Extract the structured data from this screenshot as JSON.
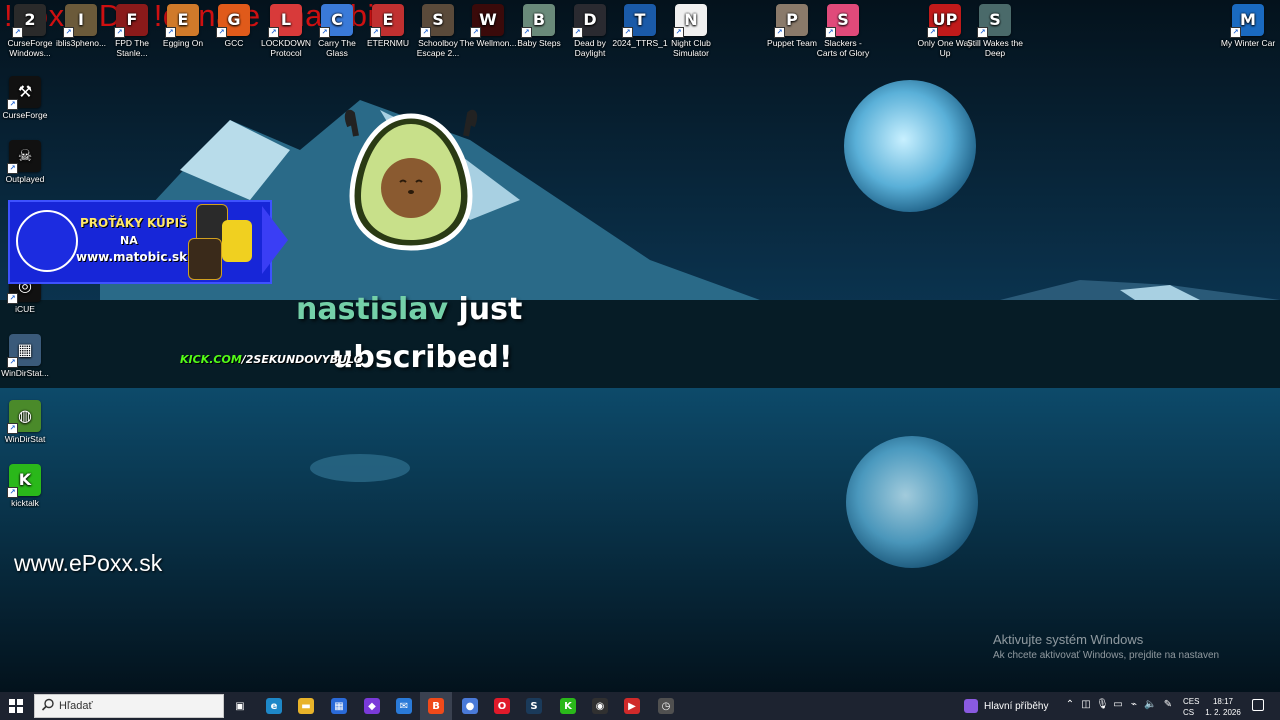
{
  "overlay": {
    "commands_text": "!doxx !DC !donate !matobic",
    "alert_user": "nastislav",
    "alert_just": "just",
    "alert_line2": "ubscribed!",
    "kick_prefix": "KICK.COM",
    "kick_suffix": "/2SEKUNDOVYBULO",
    "site_url": "www.ePoxx.sk",
    "promo": {
      "line1": "PROŤÁKY KÚPIŠ",
      "line2": "NA",
      "line3": "www.matobic.sk"
    }
  },
  "desktop": {
    "icons_top": [
      {
        "label": "CurseForge Windows...",
        "icon": "curseforge-icon",
        "color": "#2a2a2a",
        "glyph": "2"
      },
      {
        "label": "iblis3pheno...",
        "icon": "game-icon",
        "color": "#6b5a3a",
        "glyph": "I"
      },
      {
        "label": "FPD The Stanle...",
        "icon": "game-icon",
        "color": "#8a1a1a",
        "glyph": "F"
      },
      {
        "label": "Egging On",
        "icon": "egg-icon",
        "color": "#d07a2a",
        "glyph": "E"
      },
      {
        "label": "GCC",
        "icon": "gcc-icon",
        "color": "#e05a1a",
        "glyph": "G"
      },
      {
        "label": "LOCKDOWN Protocol",
        "icon": "game-icon",
        "color": "#d83a3a",
        "glyph": "L"
      },
      {
        "label": "Carry The Glass",
        "icon": "game-icon",
        "color": "#3a7ad8",
        "glyph": "C"
      },
      {
        "label": "ETERNMU",
        "icon": "game-icon",
        "color": "#c03030",
        "glyph": "E"
      },
      {
        "label": "Schoolboy Escape 2...",
        "icon": "game-icon",
        "color": "#5a4a3a",
        "glyph": "S"
      },
      {
        "label": "The Wellmon...",
        "icon": "game-icon",
        "color": "#3a0a0a",
        "glyph": "W"
      },
      {
        "label": "Baby Steps",
        "icon": "game-icon",
        "color": "#6a8a7a",
        "glyph": "B"
      },
      {
        "label": "Dead by Daylight",
        "icon": "game-icon",
        "color": "#2a2a30",
        "glyph": "D"
      },
      {
        "label": "2024_TTRS_1",
        "icon": "game-icon",
        "color": "#1a5aa8",
        "glyph": "T"
      },
      {
        "label": "Night Club Simulator",
        "icon": "game-icon",
        "color": "#f0f0f0",
        "glyph": "N"
      },
      {
        "label": "Puppet Team",
        "icon": "game-icon",
        "color": "#8a7a6a",
        "glyph": "P"
      },
      {
        "label": "Slackers - Carts of Glory",
        "icon": "game-icon",
        "color": "#e04a7a",
        "glyph": "S"
      },
      {
        "label": "Only One Way Up",
        "icon": "game-icon",
        "color": "#c01a1a",
        "glyph": "UP"
      },
      {
        "label": "Still Wakes the Deep",
        "icon": "game-icon",
        "color": "#4a6a6a",
        "glyph": "S"
      },
      {
        "label": "My Winter Car",
        "icon": "game-icon",
        "color": "#1a6ac0",
        "glyph": "M"
      }
    ],
    "icons_left": [
      {
        "label": "CurseForge",
        "icon": "curseforge-icon",
        "color": "#111111",
        "glyph": "⚒"
      },
      {
        "label": "Outplayed",
        "icon": "outplayed-icon",
        "color": "#111111",
        "glyph": "☠"
      },
      {
        "label": "iCUE",
        "icon": "icue-icon",
        "color": "#111111",
        "glyph": "◎"
      },
      {
        "label": "WinDirStat...",
        "icon": "windirstat-icon",
        "color": "#3a5a7a",
        "glyph": "▦"
      },
      {
        "label": "WinDirStat",
        "icon": "windirstat-icon",
        "color": "#4a8a2a",
        "glyph": "◍"
      },
      {
        "label": "kicktalk",
        "icon": "kick-icon",
        "color": "#2ab81a",
        "glyph": "K"
      }
    ]
  },
  "activation": {
    "title": "Aktivujte systém Windows",
    "subtitle": "Ak chcete aktivovať Windows, prejdite na nastavenia."
  },
  "taskbar": {
    "search_placeholder": "Hľadať",
    "news_label": "Hlavní příběhy",
    "lang_line1": "CES",
    "lang_line2": "CS",
    "time": "18:17",
    "date": "1. 2. 2026",
    "apps": [
      {
        "name": "taskview-button",
        "glyph": "▣",
        "color": "#1d2330"
      },
      {
        "name": "edge-button",
        "glyph": "e",
        "color": "#1e88c8"
      },
      {
        "name": "explorer-button",
        "glyph": "▬",
        "color": "#e8b32a"
      },
      {
        "name": "store-button",
        "glyph": "▦",
        "color": "#2a6ad8"
      },
      {
        "name": "m365-button",
        "glyph": "◆",
        "color": "#7a3ad8"
      },
      {
        "name": "mail-button",
        "glyph": "✉",
        "color": "#2a7ad8"
      },
      {
        "name": "brave-button",
        "glyph": "B",
        "color": "#f04a1a"
      },
      {
        "name": "app-button",
        "glyph": "●",
        "color": "#4a7ad8"
      },
      {
        "name": "opera-button",
        "glyph": "O",
        "color": "#e01a2a"
      },
      {
        "name": "steam-button",
        "glyph": "S",
        "color": "#1a3a5a"
      },
      {
        "name": "kick-button",
        "glyph": "K",
        "color": "#2ab81a"
      },
      {
        "name": "obs-button",
        "glyph": "◉",
        "color": "#303030"
      },
      {
        "name": "streamer-button",
        "glyph": "▶",
        "color": "#d02a2a"
      },
      {
        "name": "clock-app-button",
        "glyph": "◷",
        "color": "#505050"
      }
    ]
  }
}
